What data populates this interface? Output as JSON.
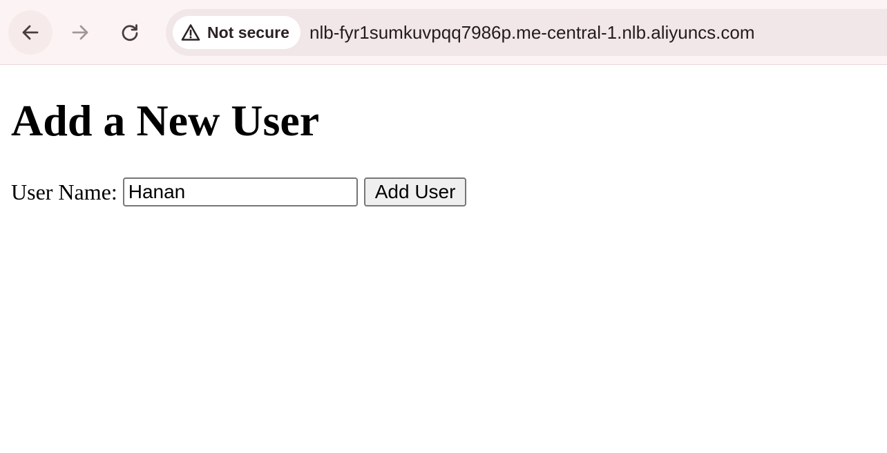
{
  "browser": {
    "security_label": "Not secure",
    "url": "nlb-fyr1sumkuvpqq7986p.me-central-1.nlb.aliyuncs.com",
    "icons": {
      "back": "arrow-left-icon",
      "forward": "arrow-right-icon",
      "reload": "reload-icon",
      "security": "warning-triangle-icon"
    }
  },
  "page": {
    "title": "Add a New User",
    "form": {
      "username_label": "User Name:",
      "username_value": "Hanan",
      "submit_label": "Add User"
    }
  }
}
